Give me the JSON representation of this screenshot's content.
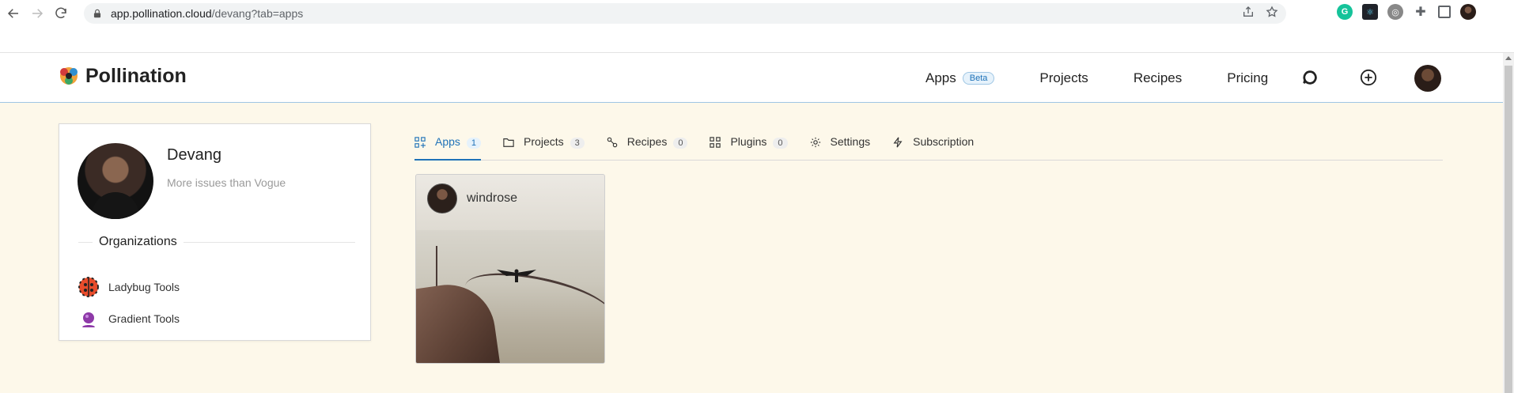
{
  "browser": {
    "url_host": "app.pollination.cloud",
    "url_path": "/devang?tab=apps"
  },
  "header": {
    "logo_text": "Pollination",
    "nav": [
      {
        "label": "Apps",
        "badge": "Beta"
      },
      {
        "label": "Projects"
      },
      {
        "label": "Recipes"
      },
      {
        "label": "Pricing"
      }
    ]
  },
  "profile": {
    "name": "Devang",
    "bio": "More issues than Vogue",
    "organizations_title": "Organizations",
    "organizations": [
      {
        "name": "Ladybug Tools",
        "icon": "ladybug-icon"
      },
      {
        "name": "Gradient Tools",
        "icon": "gradient-icon"
      }
    ]
  },
  "tabs": [
    {
      "label": "Apps",
      "count": "1",
      "icon": "apps-icon",
      "active": true
    },
    {
      "label": "Projects",
      "count": "3",
      "icon": "folder-icon"
    },
    {
      "label": "Recipes",
      "count": "0",
      "icon": "recipe-icon"
    },
    {
      "label": "Plugins",
      "count": "0",
      "icon": "plugin-icon"
    },
    {
      "label": "Settings",
      "icon": "gear-icon"
    },
    {
      "label": "Subscription",
      "icon": "bolt-icon"
    }
  ],
  "apps": [
    {
      "title": "windrose"
    }
  ],
  "colors": {
    "accent": "#1f72b8",
    "page_bg": "#fdf8ea"
  }
}
